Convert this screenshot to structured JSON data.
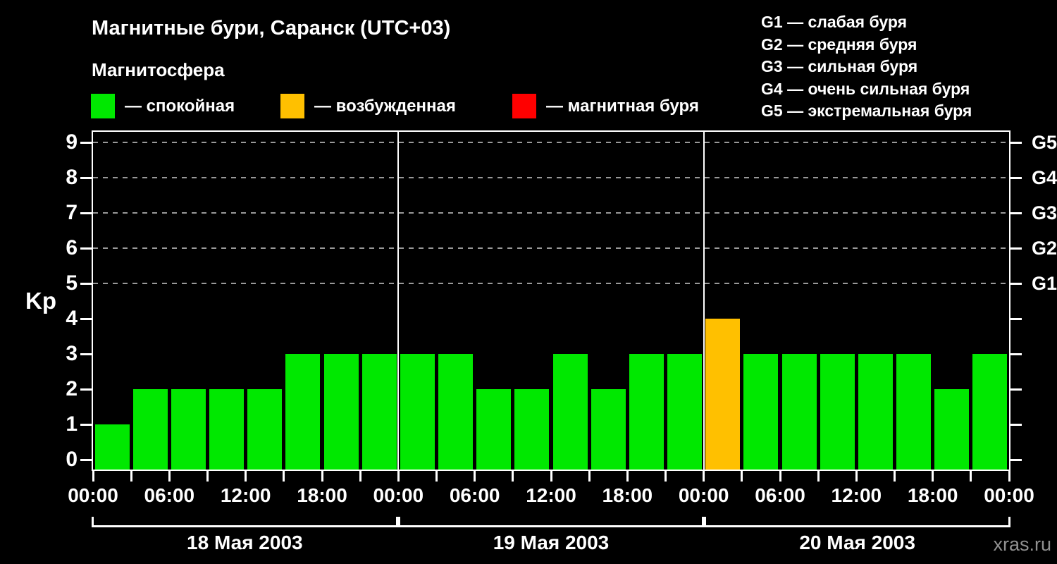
{
  "page": {
    "title": "Магнитные бури, Саранск (UTC+03)",
    "subtitle": "Магнитосфера",
    "watermark": "xras.ru"
  },
  "colors": {
    "background": "#000000",
    "text": "#ffffff",
    "quiet": "#00e800",
    "excited": "#ffc000",
    "storm": "#ff0000",
    "gridline": "#999999",
    "watermark": "#909090"
  },
  "legend": {
    "items": [
      {
        "key": "quiet",
        "label": "— спокойная"
      },
      {
        "key": "excited",
        "label": "— возбужденная"
      },
      {
        "key": "storm",
        "label": "— магнитная буря"
      }
    ]
  },
  "storm_scale_legend": {
    "items": [
      "G1 — слабая буря",
      "G2 — средняя буря",
      "G3 — сильная буря",
      "G4 — очень сильная буря",
      "G5 — экстремальная буря"
    ]
  },
  "chart_data": {
    "type": "bar",
    "title": "Магнитные бури, Саранск (UTC+03)",
    "ylabel": "Kp",
    "ylim": [
      0,
      9
    ],
    "yticks": [
      0,
      1,
      2,
      3,
      4,
      5,
      6,
      7,
      8,
      9
    ],
    "gridlines_at": [
      5,
      6,
      7,
      8,
      9
    ],
    "grid": "dashed horizontal at G-storm levels only",
    "legend_position": "top",
    "right_axis": [
      {
        "kp": 5,
        "label": "G1"
      },
      {
        "kp": 6,
        "label": "G2"
      },
      {
        "kp": 7,
        "label": "G3"
      },
      {
        "kp": 8,
        "label": "G4"
      },
      {
        "kp": 9,
        "label": "G5"
      }
    ],
    "x_tick_labels": [
      "00:00",
      "06:00",
      "12:00",
      "18:00",
      "00:00",
      "06:00",
      "12:00",
      "18:00",
      "00:00",
      "06:00",
      "12:00",
      "18:00",
      "00:00"
    ],
    "hours_per_bar": 3,
    "days": [
      {
        "date": "18 Мая 2003",
        "kp": [
          1,
          2,
          2,
          2,
          2,
          3,
          3,
          3
        ]
      },
      {
        "date": "19 Мая 2003",
        "kp": [
          3,
          3,
          2,
          2,
          3,
          2,
          3,
          3
        ]
      },
      {
        "date": "20 Мая 2003",
        "kp": [
          4,
          3,
          3,
          3,
          3,
          3,
          2,
          3
        ]
      }
    ],
    "color_rule": {
      "quiet_max_kp": 3,
      "excited_max_kp": 4
    }
  }
}
